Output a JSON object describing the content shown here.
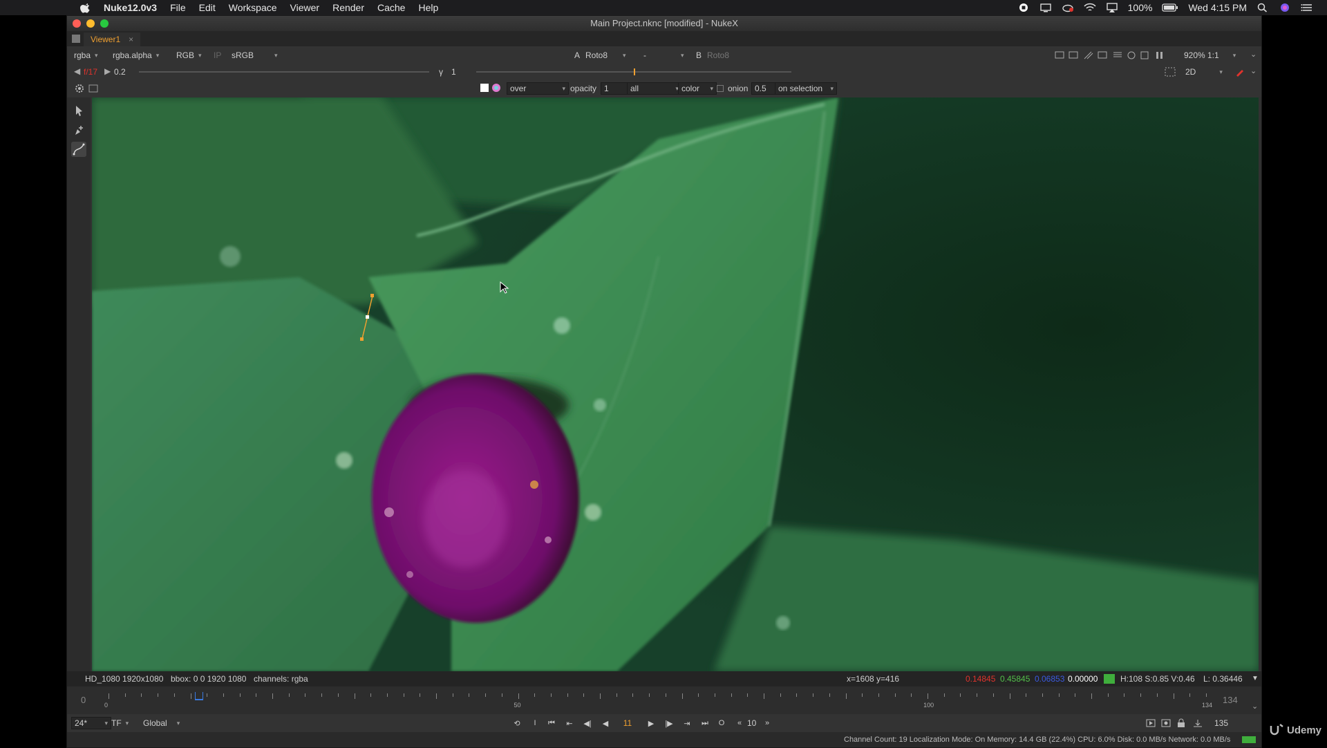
{
  "menubar": {
    "app_name": "Nuke12.0v3",
    "items": [
      "File",
      "Edit",
      "Workspace",
      "Viewer",
      "Render",
      "Cache",
      "Help"
    ],
    "battery": "100%",
    "clock": "Wed 4:15 PM"
  },
  "window": {
    "title": "Main Project.nknc [modified] - NukeX",
    "tab_label": "Viewer1"
  },
  "viewer_toolbar": {
    "channels": "rgba",
    "alpha_channel": "rgba.alpha",
    "display_channel": "RGB",
    "ip_label": "IP",
    "lut": "sRGB",
    "a_label": "A",
    "a_input": "Roto8",
    "blend_mode": "-",
    "b_label": "B",
    "b_input": "Roto8",
    "zoom": "920%",
    "ratio": "1:1"
  },
  "exposure_row": {
    "fstop": "f/17",
    "gain": "0.2",
    "gamma_label": "γ",
    "gamma": "1",
    "view_mode": "2D"
  },
  "roto_toolbar": {
    "blend": "over",
    "opacity_label": "opacity",
    "opacity": "1",
    "output": "all",
    "premult": "color",
    "onion_label": "onion",
    "onion": "0.5",
    "selection_mode": "on selection"
  },
  "infobar": {
    "format": "HD_1080 1920x1080",
    "bbox": "bbox: 0 0 1920 1080",
    "channels": "channels: rgba",
    "coords": "x=1608 y=416",
    "r": "0.14845",
    "g": "0.45845",
    "b": "0.06853",
    "a": "0.00000",
    "swatch_color": "#3fae3c",
    "hsv": "H:108 S:0.85 V:0.46",
    "luma": "L: 0.36446"
  },
  "timeline": {
    "start": "0",
    "end": "134",
    "tick_labels": [
      "0",
      "50",
      "100",
      "134"
    ],
    "first_frame": 0,
    "last_frame": 134,
    "current_frame": 11
  },
  "playback": {
    "fps": "24*",
    "tf": "TF",
    "range_mode": "Global",
    "in_label": "I",
    "out_label": "O",
    "current_frame": "11",
    "increment": "10",
    "end_frame": "135"
  },
  "status": {
    "text": "Channel Count: 19  Localization Mode: On  Memory: 14.4 GB (22.4%)  CPU: 6.0%  Disk: 0.0 MB/s  Network: 0.0 MB/s"
  },
  "watermark": "Udemy",
  "colors": {
    "accent_orange": "#f0a030",
    "viewer_bg": "#1d4a2a",
    "red_value": "#e0332c",
    "green_value": "#52c04a",
    "blue_value": "#3a5ae0"
  }
}
